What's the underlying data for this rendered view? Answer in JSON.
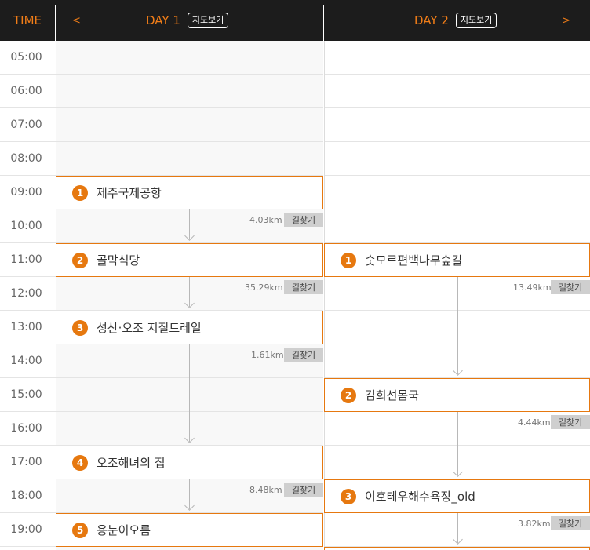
{
  "header": {
    "time_label": "TIME",
    "prev_arrow": "<",
    "next_arrow": ">",
    "day1_title": "DAY 1",
    "day2_title": "DAY 2",
    "map_button_label": "지도보기"
  },
  "times": [
    "05:00",
    "06:00",
    "07:00",
    "08:00",
    "09:00",
    "10:00",
    "11:00",
    "12:00",
    "13:00",
    "14:00",
    "15:00",
    "16:00",
    "17:00",
    "18:00",
    "19:00"
  ],
  "day1": {
    "stops": [
      {
        "num": "1",
        "name": "제주국제공항"
      },
      {
        "num": "2",
        "name": "골막식당"
      },
      {
        "num": "3",
        "name": "성산·오조 지질트레일"
      },
      {
        "num": "4",
        "name": "오조해녀의 집"
      },
      {
        "num": "5",
        "name": "용눈이오름"
      }
    ],
    "legs": [
      {
        "distance": "4.03km",
        "route_label": "길찾기"
      },
      {
        "distance": "35.29km",
        "route_label": "길찾기"
      },
      {
        "distance": "1.61km",
        "route_label": "길찾기"
      },
      {
        "distance": "8.48km",
        "route_label": "길찾기"
      }
    ]
  },
  "day2": {
    "stops": [
      {
        "num": "1",
        "name": "숫모르편백나무숲길"
      },
      {
        "num": "2",
        "name": "김희선몸국"
      },
      {
        "num": "3",
        "name": "이호테우해수욕장_old"
      }
    ],
    "legs": [
      {
        "distance": "13.49km",
        "route_label": "길찾기"
      },
      {
        "distance": "4.44km",
        "route_label": "길찾기"
      },
      {
        "distance": "3.82km",
        "route_label": "길찾기"
      }
    ]
  },
  "colors": {
    "accent": "#e6780f",
    "header_bg": "#1c1c1c"
  }
}
